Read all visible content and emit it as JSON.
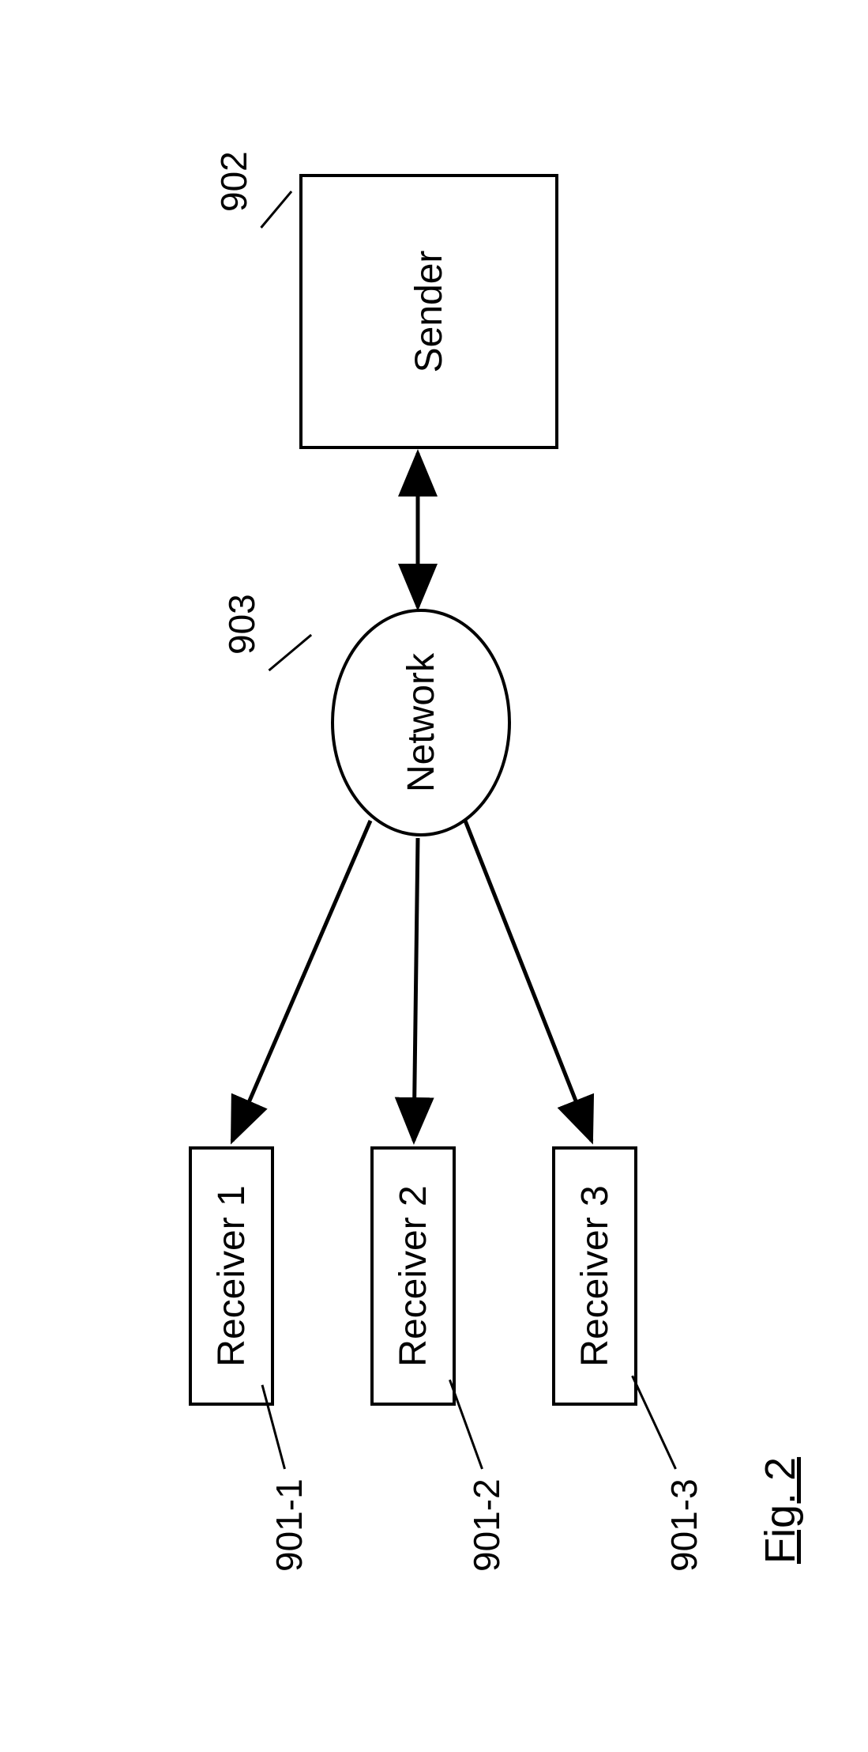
{
  "figure": {
    "label": "Fig. 2",
    "sender": {
      "label": "Sender",
      "ref": "902"
    },
    "network": {
      "label": "Network",
      "ref": "903"
    },
    "receivers": [
      {
        "label": "Receiver 1",
        "ref": "901-1"
      },
      {
        "label": "Receiver 2",
        "ref": "901-2"
      },
      {
        "label": "Receiver 3",
        "ref": "901-3"
      }
    ]
  }
}
